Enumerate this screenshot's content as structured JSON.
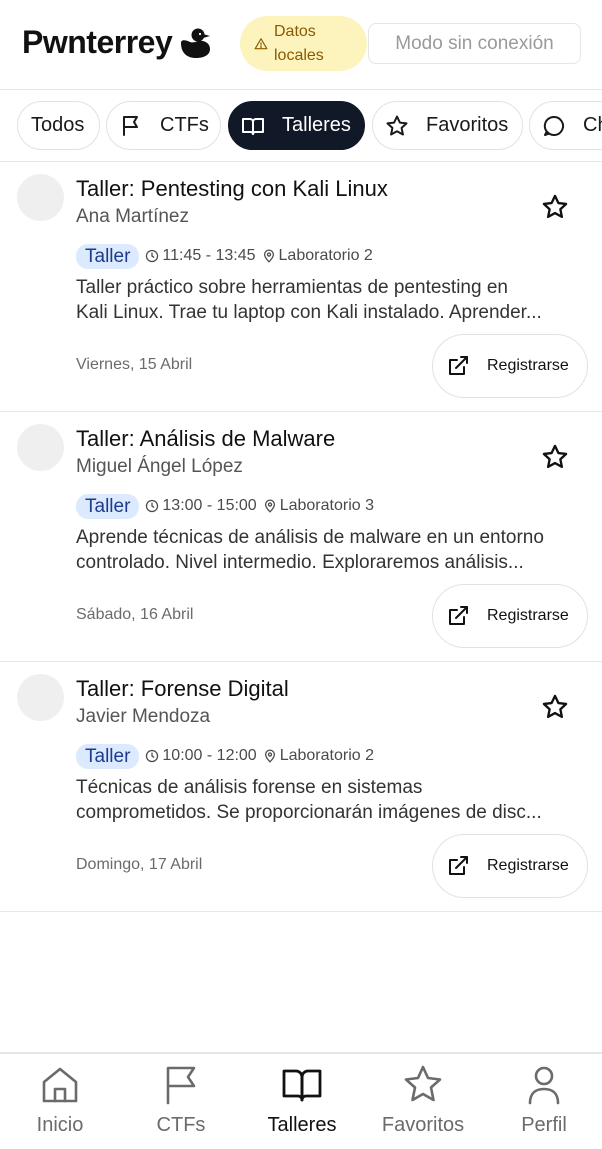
{
  "header": {
    "title": "Pwnterrey",
    "warning_line1": "Datos",
    "warning_line2": "locales",
    "offline_label": "Modo sin conexión"
  },
  "filters": [
    {
      "label": "Todos",
      "icon": "none",
      "active": false
    },
    {
      "label": "CTFs",
      "icon": "flag-icon",
      "active": false
    },
    {
      "label": "Talleres",
      "icon": "book-icon",
      "active": true
    },
    {
      "label": "Favoritos",
      "icon": "star-icon",
      "active": false
    },
    {
      "label": "Ch",
      "icon": "chat-icon",
      "active": false
    }
  ],
  "events": [
    {
      "title": "Taller: Pentesting con Kali Linux",
      "author": "Ana Martínez",
      "tag": "Taller",
      "time": "11:45 - 13:45",
      "location": "Laboratorio 2",
      "desc_line1": "Taller práctico sobre herramientas de pentesting en",
      "desc_line2": "Kali Linux. Trae tu laptop con Kali instalado. Aprender...",
      "date": "Viernes, 15 Abril",
      "action": "Registrarse"
    },
    {
      "title": "Taller: Análisis de Malware",
      "author": "Miguel Ángel López",
      "tag": "Taller",
      "time": "13:00 - 15:00",
      "location": "Laboratorio 3",
      "desc_line1": "Aprende técnicas de análisis de malware en un entorno",
      "desc_line2": "controlado. Nivel intermedio. Exploraremos análisis...",
      "date": "Sábado, 16 Abril",
      "action": "Registrarse"
    },
    {
      "title": "Taller: Forense Digital",
      "author": "Javier Mendoza",
      "tag": "Taller",
      "time": "10:00 - 12:00",
      "location": "Laboratorio 2",
      "desc_line1": "Técnicas de análisis forense en sistemas",
      "desc_line2": "comprometidos. Se proporcionarán imágenes de disc...",
      "date": "Domingo, 17 Abril",
      "action": "Registrarse"
    }
  ],
  "nav": [
    {
      "label": "Inicio",
      "icon": "home-icon",
      "active": false
    },
    {
      "label": "CTFs",
      "icon": "flag-icon",
      "active": false
    },
    {
      "label": "Talleres",
      "icon": "book-icon",
      "active": true
    },
    {
      "label": "Favoritos",
      "icon": "star-icon",
      "active": false
    },
    {
      "label": "Perfil",
      "icon": "user-icon",
      "active": false
    }
  ]
}
